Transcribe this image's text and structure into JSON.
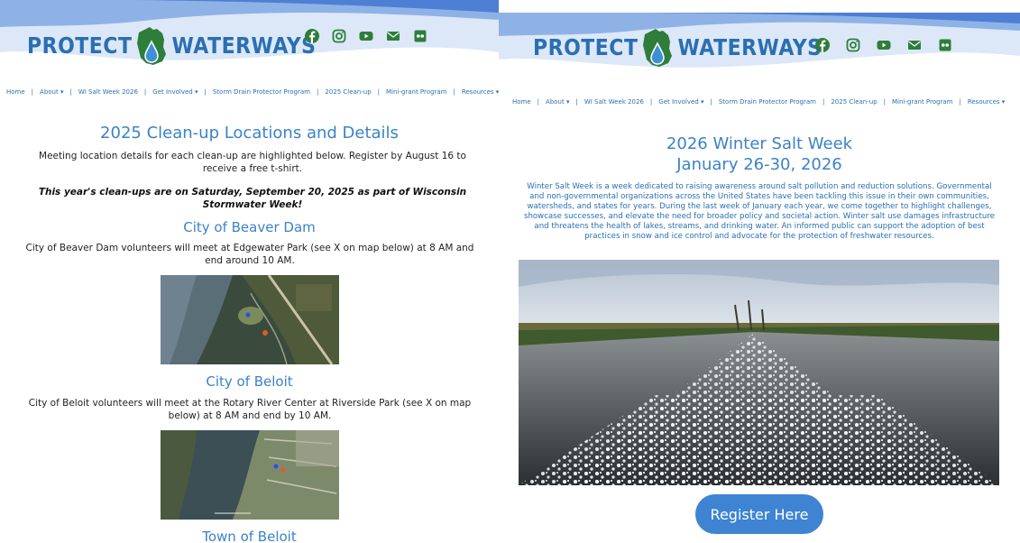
{
  "left": {
    "logo": {
      "word1": "PROTECT",
      "word2": "WATERWAYS"
    },
    "nav": [
      {
        "label": "Home",
        "dropdown": false
      },
      {
        "label": "About",
        "dropdown": true
      },
      {
        "label": "WI Salt Week 2026",
        "dropdown": false
      },
      {
        "label": "Get Involved",
        "dropdown": true
      },
      {
        "label": "Storm Drain Protector Program",
        "dropdown": false
      },
      {
        "label": "2025 Clean-up",
        "dropdown": false
      },
      {
        "label": "Mini-grant Program",
        "dropdown": false
      },
      {
        "label": "Resources",
        "dropdown": true
      }
    ],
    "title": "2025 Clean-up Locations and Details",
    "intro": "Meeting location details for each clean-up are highlighted below. Register by August 16 to receive a free t-shirt.",
    "notice": "This year's clean-ups are on Saturday, September 20, 2025 as part of Wisconsin Stormwater Week!",
    "sections": [
      {
        "heading": "City of Beaver Dam",
        "text": "City of Beaver Dam volunteers will meet at Edgewater Park (see X on map below) at 8 AM and end around 10 AM."
      },
      {
        "heading": "City of Beloit",
        "text": "City of Beloit volunteers will meet at the Rotary River Center at Riverside Park (see X on map below) at 8 AM and end by 10 AM."
      },
      {
        "heading": "Town of Beloit"
      }
    ]
  },
  "right": {
    "logo": {
      "word1": "PROTECT",
      "word2": "WATERWAYS"
    },
    "nav": [
      {
        "label": "Home",
        "dropdown": false
      },
      {
        "label": "About",
        "dropdown": true
      },
      {
        "label": "WI Salt Week 2026",
        "dropdown": false
      },
      {
        "label": "Get Involved",
        "dropdown": true
      },
      {
        "label": "Storm Drain Protector Program",
        "dropdown": false
      },
      {
        "label": "2025 Clean-up",
        "dropdown": false
      },
      {
        "label": "Mini-grant Program",
        "dropdown": false
      },
      {
        "label": "Resources",
        "dropdown": true
      }
    ],
    "title_line1": "2026 Winter Salt Week",
    "title_line2": "January 26-30, 2026",
    "description": "Winter Salt Week is a week dedicated to raising awareness around salt pollution and reduction solutions. Governmental and non-governmental organizations across the United States have been tackling this issue in their own communities, watersheds, and states for years. During the last week of January each year, we come together to highlight challenges, showcase successes, and elevate the need for broader policy and societal action. Winter salt use damages infrastructure and threatens the health of lakes, streams, and drinking water. An informed public can support the adoption of best practices in snow and ice control and advocate for the protection of freshwater resources.",
    "register_label": "Register Here"
  },
  "social_icons": [
    "facebook-icon",
    "instagram-icon",
    "youtube-icon",
    "email-icon",
    "flickr-icon"
  ],
  "colors": {
    "brand_blue": "#2a6fb3",
    "heading_blue": "#3b82c8",
    "green": "#2f7d3a",
    "button_blue": "#3e84d2"
  }
}
